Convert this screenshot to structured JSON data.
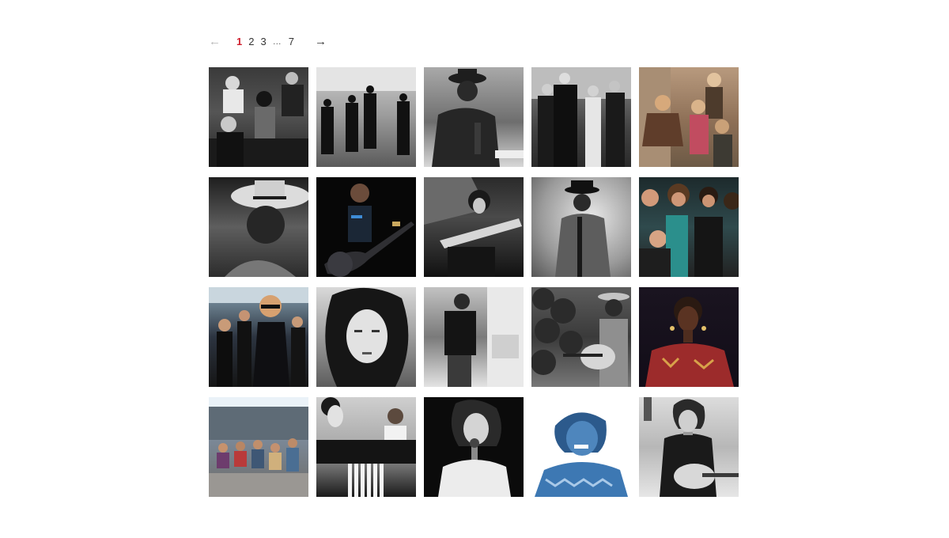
{
  "pagination": {
    "prev_label": "←",
    "pages": [
      "1",
      "2",
      "3"
    ],
    "ellipsis": "…",
    "last_page": "7",
    "next_label": "→",
    "current_page": "1",
    "current_color": "#d0202e"
  },
  "gallery": {
    "tiles": [
      {
        "name": "photo-01-bw-band-four-people"
      },
      {
        "name": "photo-02-bw-band-leather-jackets-street"
      },
      {
        "name": "photo-03-bw-man-hat-table-bottle"
      },
      {
        "name": "photo-04-bw-group-street"
      },
      {
        "name": "photo-05-sepia-band-group"
      },
      {
        "name": "photo-06-bw-man-straw-hat"
      },
      {
        "name": "photo-07-guitarist-dark-stage"
      },
      {
        "name": "photo-08-bw-guitarist-playing"
      },
      {
        "name": "photo-09-bw-man-hat-guitar"
      },
      {
        "name": "photo-10-color-band-five-members"
      },
      {
        "name": "photo-11-color-band-sunglasses"
      },
      {
        "name": "photo-12-bw-woman-curly-hair"
      },
      {
        "name": "photo-13-bw-man-doorway"
      },
      {
        "name": "photo-14-bw-man-guitar-foliage"
      },
      {
        "name": "photo-15-color-woman-earrings"
      },
      {
        "name": "photo-16-color-group-sitting-street"
      },
      {
        "name": "photo-17-bw-man-piano-child"
      },
      {
        "name": "photo-18-bw-singer-microphone"
      },
      {
        "name": "photo-19-blue-woman-smiling"
      },
      {
        "name": "photo-20-bw-man-guitar-harmonica"
      }
    ]
  }
}
